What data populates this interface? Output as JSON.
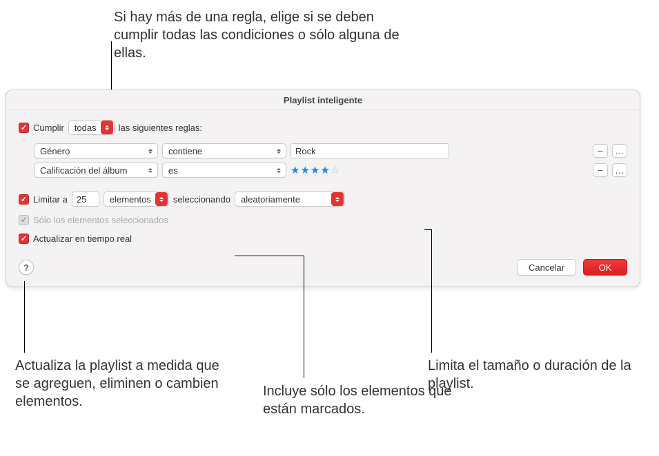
{
  "annotations": {
    "top": "Si hay más de una regla, elige si se deben cumplir todas las condiciones o sólo alguna de ellas.",
    "bottom_left": "Actualiza la playlist a medida que se agreguen, eliminen o cambien elementos.",
    "bottom_center": "Incluye sólo los elementos que están marcados.",
    "bottom_right": "Limita el tamaño o duración de la playlist."
  },
  "dialog": {
    "title": "Playlist inteligente",
    "match": {
      "prefix": "Cumplir",
      "mode": "todas",
      "suffix": "las siguientes reglas:"
    },
    "rules": [
      {
        "field": "Género",
        "operator": "contiene",
        "value": "Rock"
      },
      {
        "field": "Calificación del álbum",
        "operator": "es",
        "rating": 4,
        "rating_max": 5
      }
    ],
    "limit": {
      "prefix": "Limitar a",
      "count": "25",
      "unit": "elementos",
      "middle": "seleccionando",
      "method": "aleatoriamente"
    },
    "only_checked": "Sólo los elementos seleccionados",
    "live_update": "Actualizar en tiempo real",
    "buttons": {
      "help": "?",
      "cancel": "Cancelar",
      "ok": "OK",
      "minus": "−",
      "more": "…"
    }
  }
}
